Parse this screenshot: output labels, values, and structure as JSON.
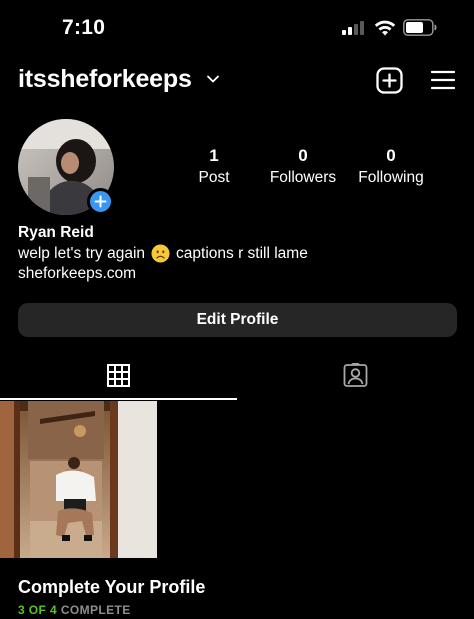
{
  "status_bar": {
    "time": "7:10"
  },
  "header": {
    "username": "itssheforkeeps",
    "icons": [
      "chevron-down-icon",
      "add-post-icon",
      "menu-icon"
    ]
  },
  "profile": {
    "stats": [
      {
        "value": "1",
        "label": "Post"
      },
      {
        "value": "0",
        "label": "Followers"
      },
      {
        "value": "0",
        "label": "Following"
      }
    ],
    "display_name": "Ryan Reid",
    "bio_before_emoji": "welp let's try again",
    "bio_emoji": "frowning-face",
    "bio_after_emoji": "captions r still lame",
    "link": "sheforkeeps.com",
    "edit_button_label": "Edit Profile"
  },
  "tabs": [
    {
      "name": "posts-grid",
      "icon": "grid-icon",
      "active": true
    },
    {
      "name": "tagged",
      "icon": "tagged-person-icon",
      "active": false
    }
  ],
  "posts_count": 1,
  "complete_profile": {
    "title": "Complete Your Profile",
    "progress_text": "3 OF 4",
    "rest_text": " COMPLETE",
    "progress_color": "#58c322"
  },
  "colors": {
    "background": "#000000",
    "accent_blue": "#3897f0",
    "button_bg": "#262626",
    "muted": "#8e8e8e"
  }
}
